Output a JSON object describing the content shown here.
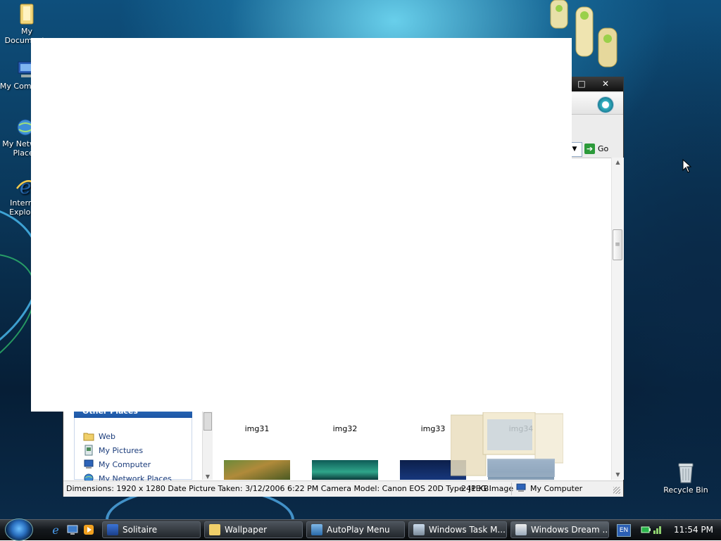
{
  "desktop": {
    "icons": [
      {
        "label": "My Documents"
      },
      {
        "label": "My Computer"
      },
      {
        "label": "My Network Places"
      },
      {
        "label": "Internet Explorer"
      }
    ],
    "recycle_bin": {
      "label": "Recycle Bin"
    }
  },
  "explorer": {
    "title_buttons": {
      "maximize": "□",
      "close": "✕"
    },
    "go_label": "Go",
    "other_places": {
      "header": "Other Places",
      "items": [
        {
          "label": "Web"
        },
        {
          "label": "My Pictures"
        },
        {
          "label": "My Computer"
        },
        {
          "label": "My Network Places"
        }
      ]
    },
    "thumbnails": [
      {
        "label": "img31"
      },
      {
        "label": "img32"
      },
      {
        "label": "img33"
      },
      {
        "label": "img34"
      }
    ],
    "status": {
      "details": "Dimensions: 1920 x 1280 Date Picture Taken: 3/12/2006 6:22 PM Camera Model: Canon EOS 20D Type: JPEG Image",
      "size": "241 KB",
      "zone": "My Computer"
    }
  },
  "taskbar": {
    "items": [
      {
        "label": "Solitaire"
      },
      {
        "label": "Wallpaper"
      },
      {
        "label": "AutoPlay Menu"
      },
      {
        "label": "Windows Task M..."
      },
      {
        "label": "Windows Dream ..."
      }
    ],
    "language": "EN",
    "clock": "11:54 PM"
  },
  "colors": {
    "taskbar": "#15191d",
    "tasks_header": "#1d56a5",
    "link_text": "#1a3b7a"
  }
}
